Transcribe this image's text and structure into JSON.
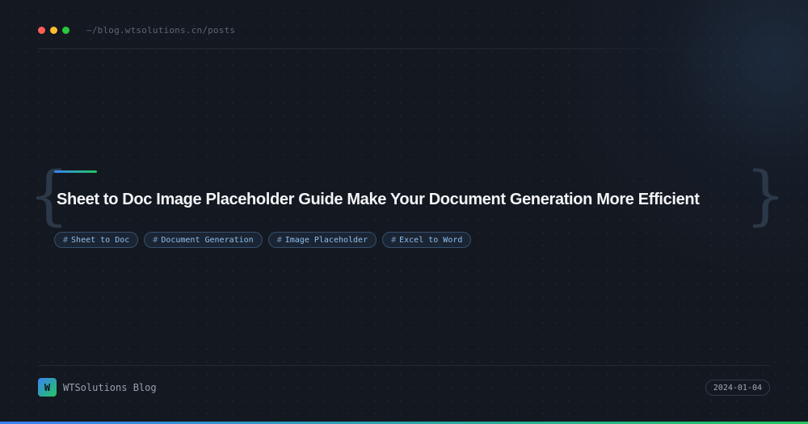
{
  "header": {
    "path": "~/blog.wtsolutions.cn/posts"
  },
  "post": {
    "brace_open": "{",
    "brace_close": "}",
    "title": "Sheet to Doc Image Placeholder Guide Make Your Document Generation More Efficient",
    "tags": [
      {
        "hash": "#",
        "label": "Sheet to Doc"
      },
      {
        "hash": "#",
        "label": "Document Generation"
      },
      {
        "hash": "#",
        "label": "Image Placeholder"
      },
      {
        "hash": "#",
        "label": "Excel to Word"
      }
    ]
  },
  "footer": {
    "logo_letter": "W",
    "brand": "WTSolutions Blog",
    "date": "2024-01-04"
  },
  "colors": {
    "background": "#141820",
    "accent_blue": "#3b82f6",
    "accent_green": "#22c55e",
    "tag_text": "#8fc0ec",
    "title_text": "#f2f4f7"
  }
}
